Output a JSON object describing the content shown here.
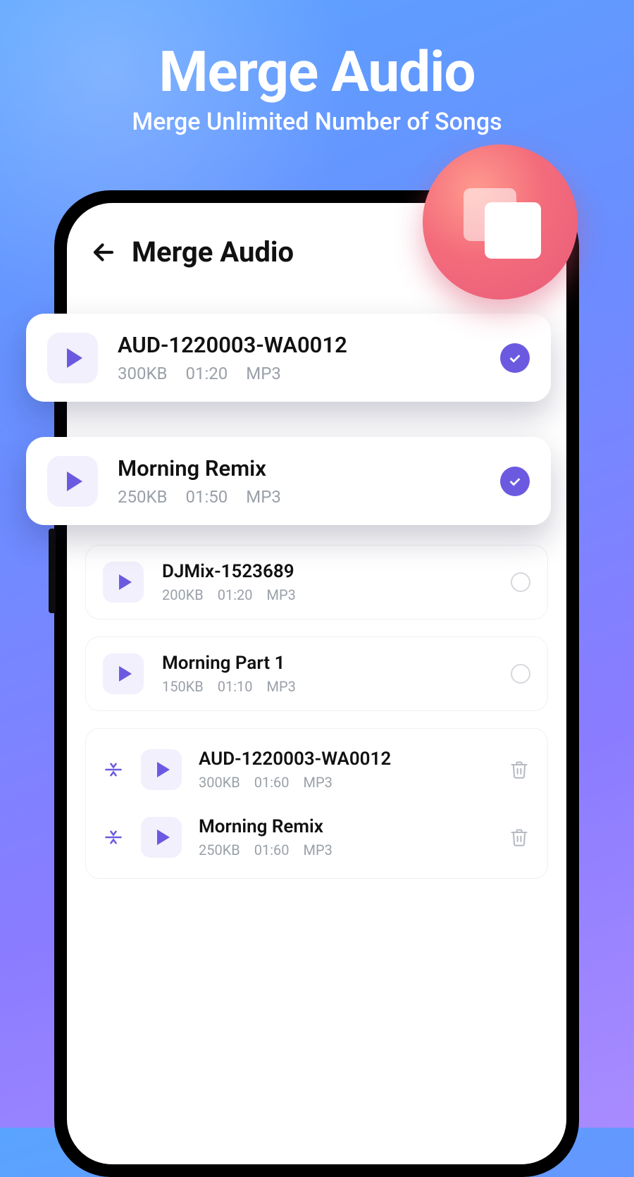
{
  "hero": {
    "title": "Merge Audio",
    "subtitle": "Merge Unlimited Number of Songs"
  },
  "colors": {
    "accent": "#6b5ae0",
    "badge": "#f36c7b"
  },
  "app": {
    "header_title": "Merge Audio"
  },
  "pop_cards": [
    {
      "title": "AUD-1220003-WA0012",
      "size": "300KB",
      "duration": "01:20",
      "format": "MP3",
      "selected": true
    },
    {
      "title": "Morning Remix",
      "size": "250KB",
      "duration": "01:50",
      "format": "MP3",
      "selected": true
    }
  ],
  "inner_cards": [
    {
      "title": "DJMix-1523689",
      "size": "200KB",
      "duration": "01:20",
      "format": "MP3",
      "selected": false
    },
    {
      "title": "Morning Part 1",
      "size": "150KB",
      "duration": "01:10",
      "format": "MP3",
      "selected": false
    }
  ],
  "queue": [
    {
      "title": "AUD-1220003-WA0012",
      "size": "300KB",
      "duration": "01:60",
      "format": "MP3"
    },
    {
      "title": "Morning Remix",
      "size": "250KB",
      "duration": "01:60",
      "format": "MP3"
    }
  ]
}
